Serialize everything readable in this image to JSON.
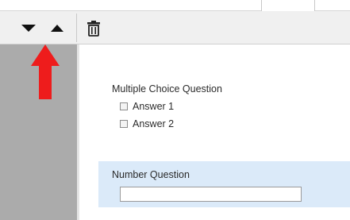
{
  "toolbar": {
    "move_down_icon": "triangle-down-icon",
    "move_up_icon": "triangle-up-icon",
    "delete_icon": "trash-icon"
  },
  "annotation": {
    "icon": "arrow-up-icon",
    "color": "#ee1c1c"
  },
  "questions": [
    {
      "title": "Multiple Choice Question",
      "type": "checkbox",
      "options": [
        "Answer 1",
        "Answer 2"
      ]
    },
    {
      "title": "Number Question",
      "type": "number",
      "value": "",
      "selected": true
    }
  ],
  "colors": {
    "sidebar": "#ababab",
    "toolbar": "#f0f0f0",
    "selected_question": "#dbeaf9",
    "annotation_arrow": "#ee1c1c"
  }
}
